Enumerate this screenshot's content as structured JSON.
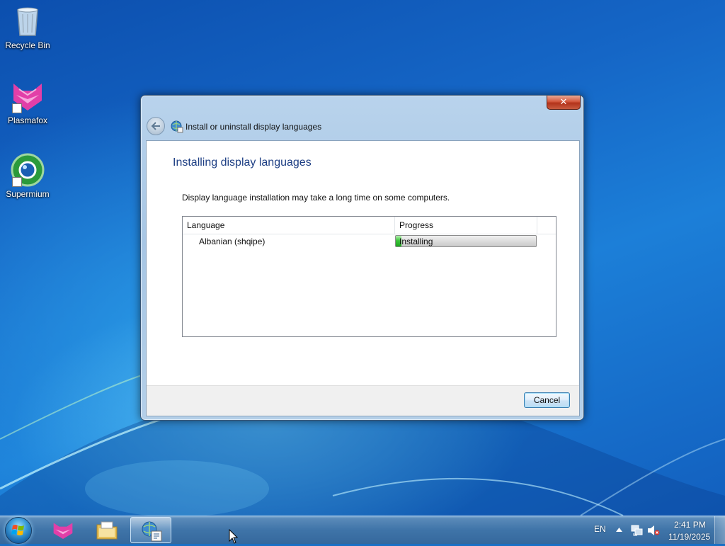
{
  "desktop": {
    "icons": [
      {
        "label": "Recycle Bin",
        "icon": "recycle-bin-icon"
      },
      {
        "label": "Plasmafox",
        "icon": "plasmafox-icon"
      },
      {
        "label": "Supermium",
        "icon": "supermium-icon"
      }
    ]
  },
  "dialog": {
    "close_label": "✕",
    "nav_title": "Install or uninstall display languages",
    "heading": "Installing display languages",
    "description": "Display language installation may take a long time on some computers.",
    "columns": [
      "Language",
      "Progress"
    ],
    "rows": [
      {
        "language": "Albanian (shqipe)",
        "status": "Installing",
        "progress": 0.04
      }
    ],
    "cancel_label": "Cancel"
  },
  "taskbar": {
    "pinned": [
      "start-orb",
      "plasmafox-taskbar-icon",
      "file-explorer-icon",
      "language-settings-icon"
    ],
    "language": "EN",
    "time": "2:41 PM",
    "date": "11/19/2025"
  },
  "colors": {
    "heading": "#1e3f84",
    "progress_fill": "#2fb52e",
    "close_button": "#c8452b"
  }
}
